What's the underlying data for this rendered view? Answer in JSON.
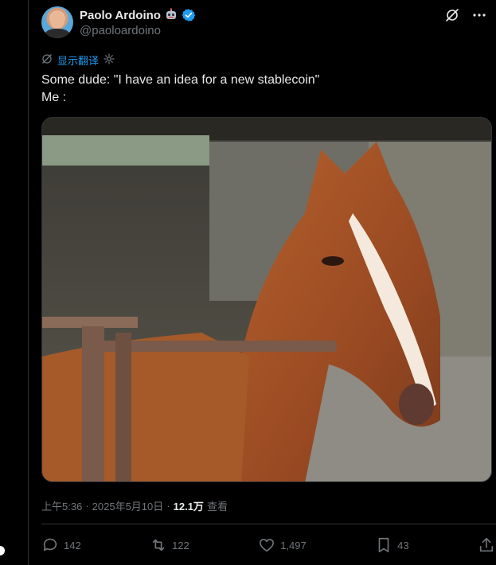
{
  "author": {
    "display_name": "Paolo Ardoino",
    "handle": "@paoloardoino",
    "name_emoji": "robot-emoji-icon",
    "verified_color": "#1d9bf0"
  },
  "translate": {
    "label": "显示翻译"
  },
  "tweet": {
    "line1": "Some dude: \"I have an idea for a new stablecoin\"",
    "line2": "Me :"
  },
  "meta": {
    "time": "上午5:36",
    "sep1": "·",
    "date": "2025年5月10日",
    "sep2": "·",
    "views": "12.1万",
    "views_label": "查看"
  },
  "actions": {
    "replies": "142",
    "reposts": "122",
    "likes": "1,497",
    "bookmarks": "43"
  },
  "colors": {
    "accent": "#1d9bf0",
    "muted": "#71767b",
    "text": "#e7e9ea",
    "background": "#000000"
  }
}
